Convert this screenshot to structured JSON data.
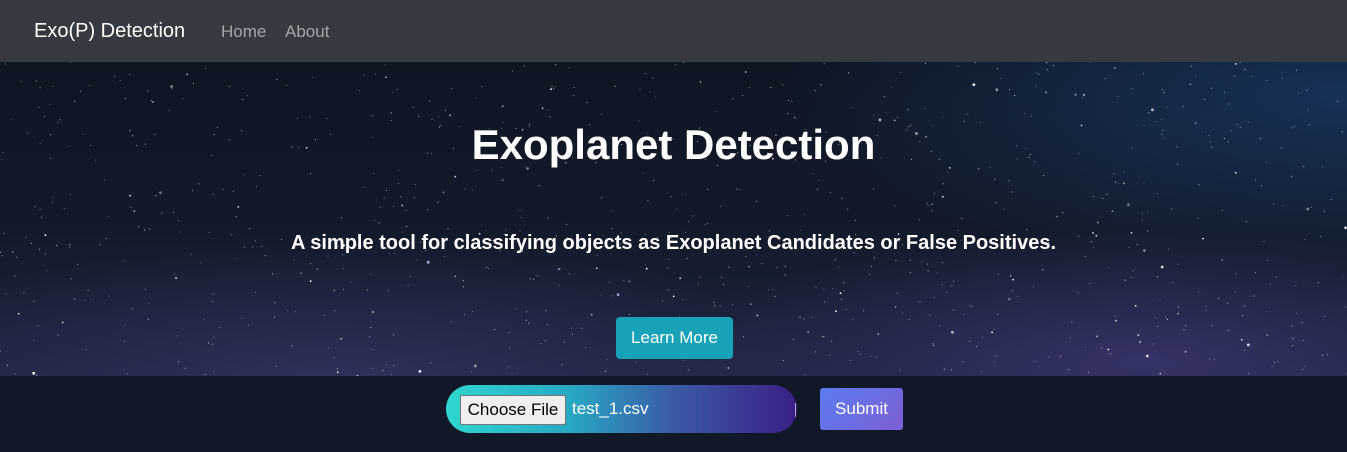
{
  "navbar": {
    "brand": "Exo(P) Detection",
    "links": [
      {
        "label": "Home"
      },
      {
        "label": "About"
      }
    ]
  },
  "hero": {
    "title": "Exoplanet Detection",
    "subtitle": "A simple tool for classifying objects as Exoplanet Candidates or False Positives.",
    "cta_label": "Learn More"
  },
  "upload": {
    "choose_label": "Choose File",
    "file_name": "test_1.csv",
    "submit_label": "Submit"
  },
  "colors": {
    "navbar_bg": "#343a40",
    "cta_bg": "#17a2b8",
    "footer_bg": "#111827",
    "submit_from": "#5b7cf0",
    "submit_to": "#7d5fd6"
  }
}
